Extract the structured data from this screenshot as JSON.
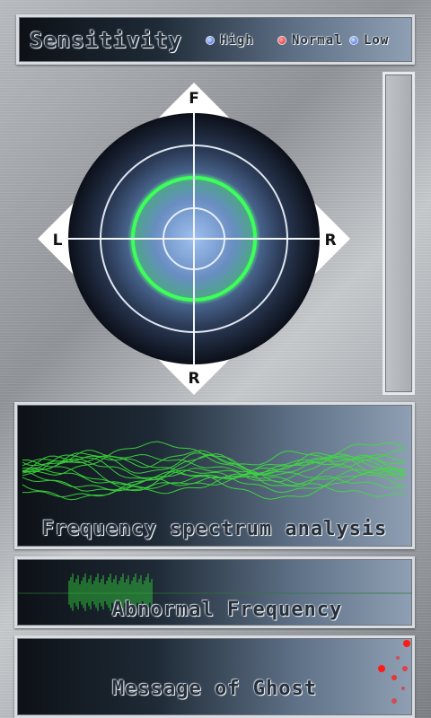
{
  "sensitivity": {
    "title": "Sensitivity",
    "options": [
      {
        "label": "High",
        "selected": false
      },
      {
        "label": "Normal",
        "selected": true
      },
      {
        "label": "Low",
        "selected": false
      }
    ],
    "colors": {
      "selected": "#e01010",
      "unselected": "#2a54d6"
    }
  },
  "radar": {
    "front_label": "F",
    "left_label": "L",
    "right_label": "R",
    "back_label": "R",
    "detection_color": "#3cff5a",
    "core_color": "#7fa8e6"
  },
  "spectrum": {
    "title": "Frequency spectrum analysis",
    "wave_color": "#3ddf3d"
  },
  "abnormal": {
    "title": "Abnormal Frequency",
    "wave_color": "#2fbf3a"
  },
  "ghost": {
    "title": "Message of Ghost",
    "dot_color": "#ff1a1a"
  }
}
